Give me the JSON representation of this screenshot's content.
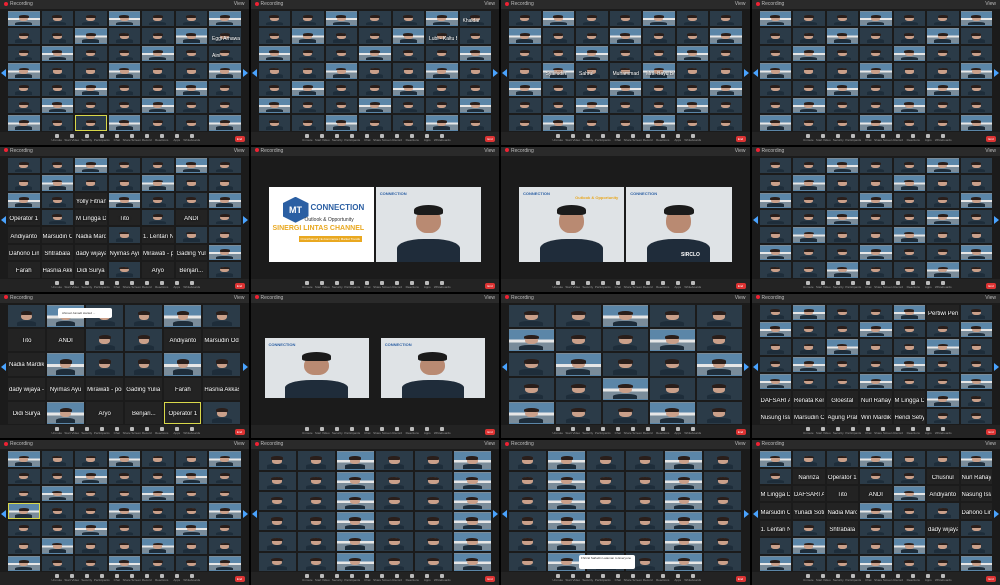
{
  "controls": [
    "Unmute",
    "Start Video",
    "Security",
    "Participants",
    "Chat",
    "Share Screen",
    "Record",
    "Reactions",
    "Apps",
    "Whiteboards",
    "End"
  ],
  "titlebar": {
    "app": "Recording",
    "view": "View"
  },
  "panels": [
    {
      "type": "gallery",
      "cols": 7,
      "rows": 7,
      "names": [
        "",
        "",
        "",
        "",
        "",
        "",
        "",
        "",
        "",
        "",
        "",
        "",
        "",
        "Eggi Arnawan",
        "",
        "",
        "",
        "",
        "",
        "",
        "Aini",
        "",
        "",
        "",
        "",
        "",
        "",
        "",
        "",
        "",
        "",
        "",
        "",
        "",
        "",
        "",
        "",
        "",
        "",
        "",
        "",
        "",
        "",
        "",
        "",
        "",
        "",
        "",
        ""
      ],
      "hl": [
        44
      ]
    },
    {
      "type": "gallery",
      "cols": 7,
      "rows": 7,
      "names": [
        "",
        "",
        "",
        "",
        "",
        "",
        "Khaidar",
        "",
        "",
        "",
        "",
        "",
        "Lubi - Kaltu Bkku",
        "",
        "",
        "",
        "",
        "",
        "",
        "",
        "",
        "",
        "",
        "",
        "",
        "",
        "",
        "",
        "",
        "",
        "",
        "",
        "",
        "",
        "",
        "",
        "",
        "",
        "",
        "",
        "",
        "",
        "",
        "",
        "",
        "",
        "",
        "",
        ""
      ],
      "hl": []
    },
    {
      "type": "gallery",
      "cols": 7,
      "rows": 7,
      "names": [
        "",
        "",
        "",
        "",
        "",
        "",
        "",
        "",
        "",
        "",
        "",
        "",
        "",
        "",
        "",
        "",
        "",
        "",
        "",
        "",
        "",
        "",
        "Syaifudin",
        "Sahrul",
        "Muhammad Raihan",
        "Mrs. Bayu Bdk",
        "",
        "",
        "",
        "",
        "",
        "",
        "",
        "",
        "",
        "",
        "",
        "",
        "",
        "",
        "",
        "",
        "",
        "",
        "",
        "",
        "",
        "",
        ""
      ],
      "hl": []
    },
    {
      "type": "gallery",
      "cols": 7,
      "rows": 7,
      "names": [
        "",
        "",
        "",
        "",
        "",
        "",
        "",
        "",
        "",
        "",
        "",
        "",
        "",
        "",
        "",
        "",
        "",
        "",
        "",
        "",
        "",
        "",
        "",
        "",
        "",
        "",
        "",
        "",
        "",
        "",
        "",
        "",
        "",
        "",
        "",
        "",
        "",
        "",
        "",
        "",
        "",
        "",
        "",
        "",
        "",
        "",
        "",
        "",
        ""
      ],
      "hl": []
    },
    {
      "type": "list",
      "cols": 7,
      "rows": 7,
      "names": [
        "",
        "",
        "",
        "",
        "",
        "",
        "",
        "",
        "",
        "",
        "",
        "",
        "",
        "",
        "",
        "",
        "Yolly Fitriani",
        "",
        "",
        "",
        "",
        "Operator 1",
        "",
        "M Lingga Dary...",
        "Tito",
        "",
        "ANDI",
        "",
        "Andiyanto",
        "Marsudin Odis",
        "Nadia Mardika",
        "",
        "1. Lentari Nugr...",
        "",
        "",
        "Dahono Lim",
        "Shtrabala",
        "dady wijaya - S...",
        "Nyimas Ayu",
        "Mirawati - porta...",
        "Gading Yulia Yo...",
        "",
        "Farah",
        "Hasnia Akkas",
        "Didi Surya",
        "",
        "Aryo",
        "Benjari...",
        ""
      ],
      "hl": []
    },
    {
      "type": "speaker",
      "variant": "logo"
    },
    {
      "type": "speaker",
      "variant": "two"
    },
    {
      "type": "gallery",
      "cols": 7,
      "rows": 7,
      "names": [
        "",
        "",
        "",
        "",
        "",
        "",
        "",
        "",
        "",
        "",
        "",
        "",
        "",
        "",
        "",
        "",
        "",
        "",
        "",
        "",
        "",
        "",
        "",
        "",
        "",
        "",
        "",
        "",
        "",
        "",
        "",
        "",
        "",
        "",
        "",
        "",
        "",
        "",
        "",
        "",
        "",
        "",
        "",
        "",
        "",
        "",
        "",
        "",
        ""
      ],
      "hl": []
    },
    {
      "type": "list",
      "cols": 6,
      "rows": 5,
      "names": [
        "",
        "",
        "",
        "",
        "",
        "",
        "Tito",
        "ANDI",
        "",
        "",
        "Andiyanto",
        "Marsudin Odis",
        "Nadia Mardika",
        "",
        "",
        "",
        "",
        "",
        "dady wijaya - S...",
        "Nyimas Ayu",
        "Mirawati - porta...",
        "Gading Yulia Yo...",
        "Farah",
        "Hasnia Akkas",
        "Didi Surya",
        "",
        "Aryo",
        "Benjari...",
        "Operator 1",
        ""
      ],
      "hl": [
        28
      ]
    },
    {
      "type": "speaker",
      "variant": "pair"
    },
    {
      "type": "gallery",
      "cols": 5,
      "rows": 5,
      "names": [
        "",
        "",
        "",
        "",
        "",
        "",
        "",
        "",
        "",
        "",
        "",
        "",
        "",
        "",
        "",
        "",
        "",
        "",
        "",
        "",
        "",
        "",
        "",
        "",
        ""
      ],
      "hl": []
    },
    {
      "type": "list",
      "cols": 7,
      "rows": 7,
      "names": [
        "",
        "",
        "",
        "",
        "",
        "Pertiwi Permata",
        "",
        "",
        "",
        "",
        "",
        "",
        "",
        "",
        "",
        "",
        "",
        "",
        "",
        "",
        "",
        "",
        "",
        "",
        "",
        "",
        "",
        "",
        "",
        "",
        "",
        "",
        "",
        "",
        "",
        "DAFSARI AMIN",
        "Renata Kencani",
        "Gloestal",
        "Nurl Rahayu S.E",
        "M Lingga Dary...",
        "",
        "",
        "Nusung Islah",
        "Marsudin Odis",
        "Agung Prabowo",
        "Win Mardika",
        "Hendi Setiyanto",
        "",
        ""
      ],
      "hl": []
    },
    {
      "type": "gallery",
      "cols": 7,
      "rows": 7,
      "names": [
        "",
        "",
        "",
        "",
        "",
        "",
        "",
        "",
        "",
        "",
        "",
        "",
        "",
        "",
        "",
        "",
        "",
        "",
        "",
        "",
        "",
        "",
        "",
        "",
        "",
        "",
        "",
        "",
        "",
        "",
        "",
        "",
        "",
        "",
        "",
        "",
        "",
        "",
        "",
        "",
        "",
        "",
        "",
        "",
        "",
        "",
        "",
        "",
        ""
      ],
      "hl": [
        21
      ]
    },
    {
      "type": "gallery",
      "cols": 6,
      "rows": 6,
      "names": [
        "",
        "",
        "",
        "",
        "",
        "",
        "",
        "",
        "",
        "",
        "",
        "",
        "",
        "",
        "",
        "",
        "",
        "",
        "",
        "",
        "",
        "",
        "",
        "",
        "",
        "",
        "",
        "",
        "",
        "",
        "",
        "",
        "",
        "",
        "",
        ""
      ],
      "hl": []
    },
    {
      "type": "gallery",
      "cols": 6,
      "rows": 6,
      "names": [
        "",
        "",
        "",
        "",
        "",
        "",
        "",
        "",
        "",
        "",
        "",
        "",
        "",
        "",
        "",
        "",
        "",
        "",
        "",
        "",
        "",
        "",
        "",
        "",
        "",
        "",
        "",
        "",
        "",
        "",
        "",
        "",
        "",
        "",
        "",
        ""
      ],
      "hl": []
    },
    {
      "type": "list",
      "cols": 7,
      "rows": 7,
      "names": [
        "",
        "",
        "",
        "",
        "",
        "",
        "",
        "",
        "Nanriza",
        "Operator 1",
        "",
        "",
        "Chusnul",
        "Nurl Rahayu S.E",
        "M Lingga Dary...",
        "DAFSARI AMIN",
        "Tito",
        "ANDI",
        "",
        "Andiyanto",
        "Nasung Islah",
        "Marsudin Odis",
        "Yunadi Sotiyanto",
        "Nadia Mardika",
        "",
        "",
        "",
        "Dahono Lim",
        "1. Lentari Nugr...",
        "",
        "Shtrabala",
        "",
        "",
        "dady wijaya - S...",
        "",
        "",
        "",
        "",
        "",
        "",
        "",
        "",
        "",
        "",
        "",
        "",
        "",
        "",
        ""
      ],
      "hl": []
    }
  ],
  "logo_text": {
    "mt": "MT",
    "connection": "CONNECTION",
    "subtitle": "Outlook & Opportunity",
    "theme": "SINERGI LINTAS CHANNEL",
    "tags": "Omnichannel | E-Commerce | Market Trends",
    "sirclo": "SIRCLO"
  },
  "notices": {
    "toast_top": "Ahmad Jumadi started ...",
    "toast_bottom": "Fhrizal Saifudin Lataman to Everyone"
  },
  "colors": {
    "bg": "#000000",
    "window": "#1b1b1b",
    "highlight": "#d8d84a",
    "arrow": "#4aa3ff",
    "end": "#dd3333",
    "brand": "#2b5fa3",
    "accent": "#e9a820"
  }
}
